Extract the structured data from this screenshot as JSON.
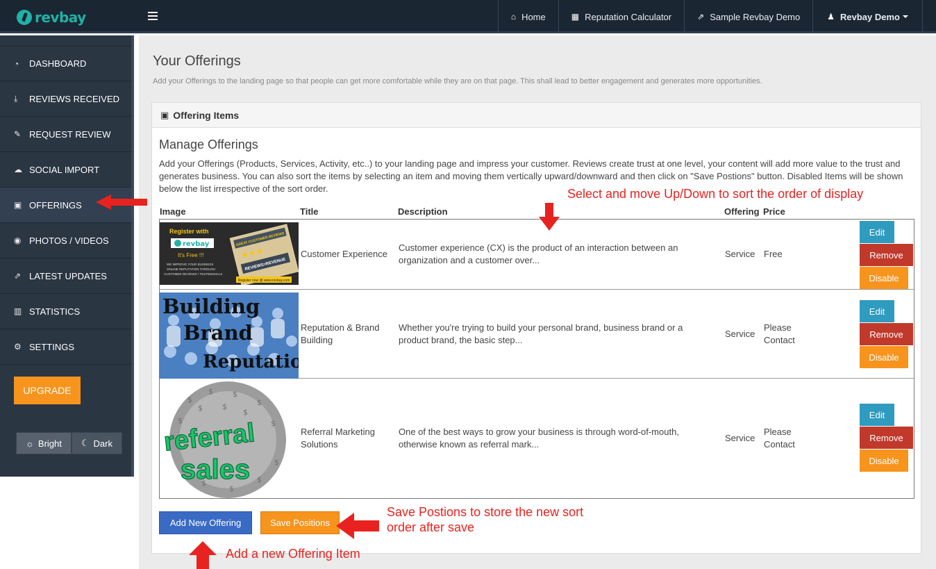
{
  "brand": {
    "name": "revbay"
  },
  "topnav": [
    {
      "label": "Home",
      "icon": "⌂"
    },
    {
      "label": "Reputation Calculator",
      "icon": "▦"
    },
    {
      "label": "Sample Revbay Demo",
      "icon": "⇗"
    },
    {
      "label": "Revbay Demo",
      "icon": "♟"
    }
  ],
  "sidebar": {
    "items": [
      {
        "label": "DASHBOARD",
        "icon": "◔"
      },
      {
        "label": "REVIEWS RECEIVED",
        "icon": "⤓"
      },
      {
        "label": "REQUEST REVIEW",
        "icon": "✎"
      },
      {
        "label": "SOCIAL IMPORT",
        "icon": "☁"
      },
      {
        "label": "OFFERINGS",
        "icon": "▣"
      },
      {
        "label": "PHOTOS / VIDEOS",
        "icon": "◉"
      },
      {
        "label": "LATEST UPDATES",
        "icon": "⇗"
      },
      {
        "label": "STATISTICS",
        "icon": "▥"
      },
      {
        "label": "SETTINGS",
        "icon": "⚙"
      }
    ],
    "upgrade_label": "UPGRADE",
    "theme": {
      "bright": "Bright",
      "dark": "Dark",
      "bright_icon": "☼",
      "dark_icon": "☾"
    }
  },
  "page": {
    "title": "Your Offerings",
    "subtitle": "Add your Offerings to the landing page so that people can get more comfortable while they are on that page. This shall lead to better engagement and generates more opportunities."
  },
  "panel": {
    "head_a": "Offering",
    "head_b": "Items",
    "section_title": "Manage Offerings",
    "section_desc": "Add your Offerings (Products, Services, Activity, etc..) to your landing page and impress your customer. Reviews create trust at one level, your content will add more value to the trust and generates business. You can also sort the items by selecting an item and moving them vertically upward/downward and then click on \"Save Postions\" button. Disabled Items will be shown below the list irrespective of the sort order."
  },
  "table": {
    "headers": {
      "image": "Image",
      "title": "Title",
      "description": "Description",
      "offering": "Offering",
      "price": "Price"
    },
    "rows": [
      {
        "title": "Customer Experience",
        "description": "Customer experience (CX) is the product of an interaction between an organization and a customer over...",
        "offering": "Service",
        "price": "Free",
        "thumb": {
          "line1": "Register with",
          "brand": "revbay",
          "line2": "It's Free !!!",
          "line3": "WE IMPROVE YOUR BUSINESS",
          "line4": "ONLINE REPUTATION THROUGH",
          "line5": "CUSTOMER REVIEWS / TESTIMONIALS",
          "card1": "GREAT CUSTOMER REVIEWS",
          "card2": "REVIEWS=REVENUE",
          "card3": "Register now @ www.revbay.com"
        }
      },
      {
        "title": "Reputation & Brand Building",
        "description": "Whether you're trying to build your personal brand, business brand or a product brand, the basic step...",
        "offering": "Service",
        "price": "Please Contact",
        "thumb": {
          "w1": "Building",
          "w2": "Brand",
          "w3": "Reputation"
        }
      },
      {
        "title": "Referral Marketing Solutions",
        "description": "One of the best ways to grow your business is through word-of-mouth, otherwise known as referral mark...",
        "offering": "Service",
        "price": "Please Contact",
        "thumb": {
          "w1": "referral",
          "w2": "sales"
        }
      }
    ],
    "actions": {
      "edit": "Edit",
      "remove": "Remove",
      "disable": "Disable"
    }
  },
  "buttons": {
    "add": "Add New Offering",
    "save": "Save Positions"
  },
  "annotations": {
    "sort": "Select and move Up/Down to sort the order of display",
    "save_1": "Save Postions to store the new sort",
    "save_2": "order after save",
    "add": "Add a new Offering Item"
  },
  "colors": {
    "accent": "#1fb2a6",
    "annotation": "#e8231f",
    "orange": "#f7941d",
    "edit": "#2f9bbf",
    "remove": "#c0392b",
    "add": "#3a6bc4"
  }
}
